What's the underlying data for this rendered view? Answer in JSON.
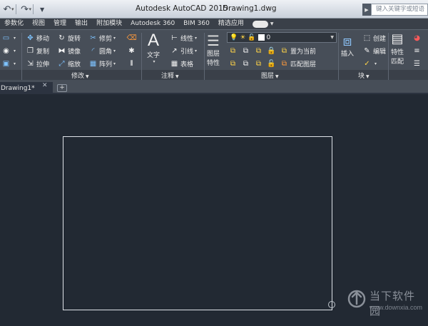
{
  "title": {
    "app": "Autodesk AutoCAD 2015",
    "file": "Drawing1.dwg",
    "search_placeholder": "键入关键字或短语"
  },
  "quick_access": [
    "undo-icon",
    "redo-icon",
    "customize-dropdown-icon"
  ],
  "tabs": [
    {
      "label": "参数化"
    },
    {
      "label": "视图"
    },
    {
      "label": "管理"
    },
    {
      "label": "输出"
    },
    {
      "label": "附加模块"
    },
    {
      "label": "Autodesk 360"
    },
    {
      "label": "BIM 360"
    },
    {
      "label": "精选应用"
    }
  ],
  "ribbon": {
    "modify": {
      "label": "修改",
      "move": "移动",
      "rotate": "旋转",
      "trim": "修剪",
      "copy": "复制",
      "mirror": "镜像",
      "fillet": "圆角",
      "stretch": "拉伸",
      "scale": "缩放",
      "array": "阵列"
    },
    "annotation": {
      "label": "注释",
      "text": "文字",
      "linear": "线性",
      "leader": "引线",
      "table": "表格"
    },
    "layers": {
      "label": "图层",
      "properties_line1": "图层",
      "properties_line2": "特性",
      "current_layer": "0",
      "set_current": "置为当前",
      "match_layer": "匹配图层"
    },
    "block": {
      "label": "块",
      "insert": "插入",
      "create": "创建",
      "edit": "编辑"
    },
    "properties": {
      "match_line1": "特性",
      "match_line2": "匹配"
    }
  },
  "document_tabs": [
    {
      "label": "Drawing1*"
    }
  ],
  "watermark": {
    "name": "当下软件园",
    "url": "www.downxia.com"
  }
}
